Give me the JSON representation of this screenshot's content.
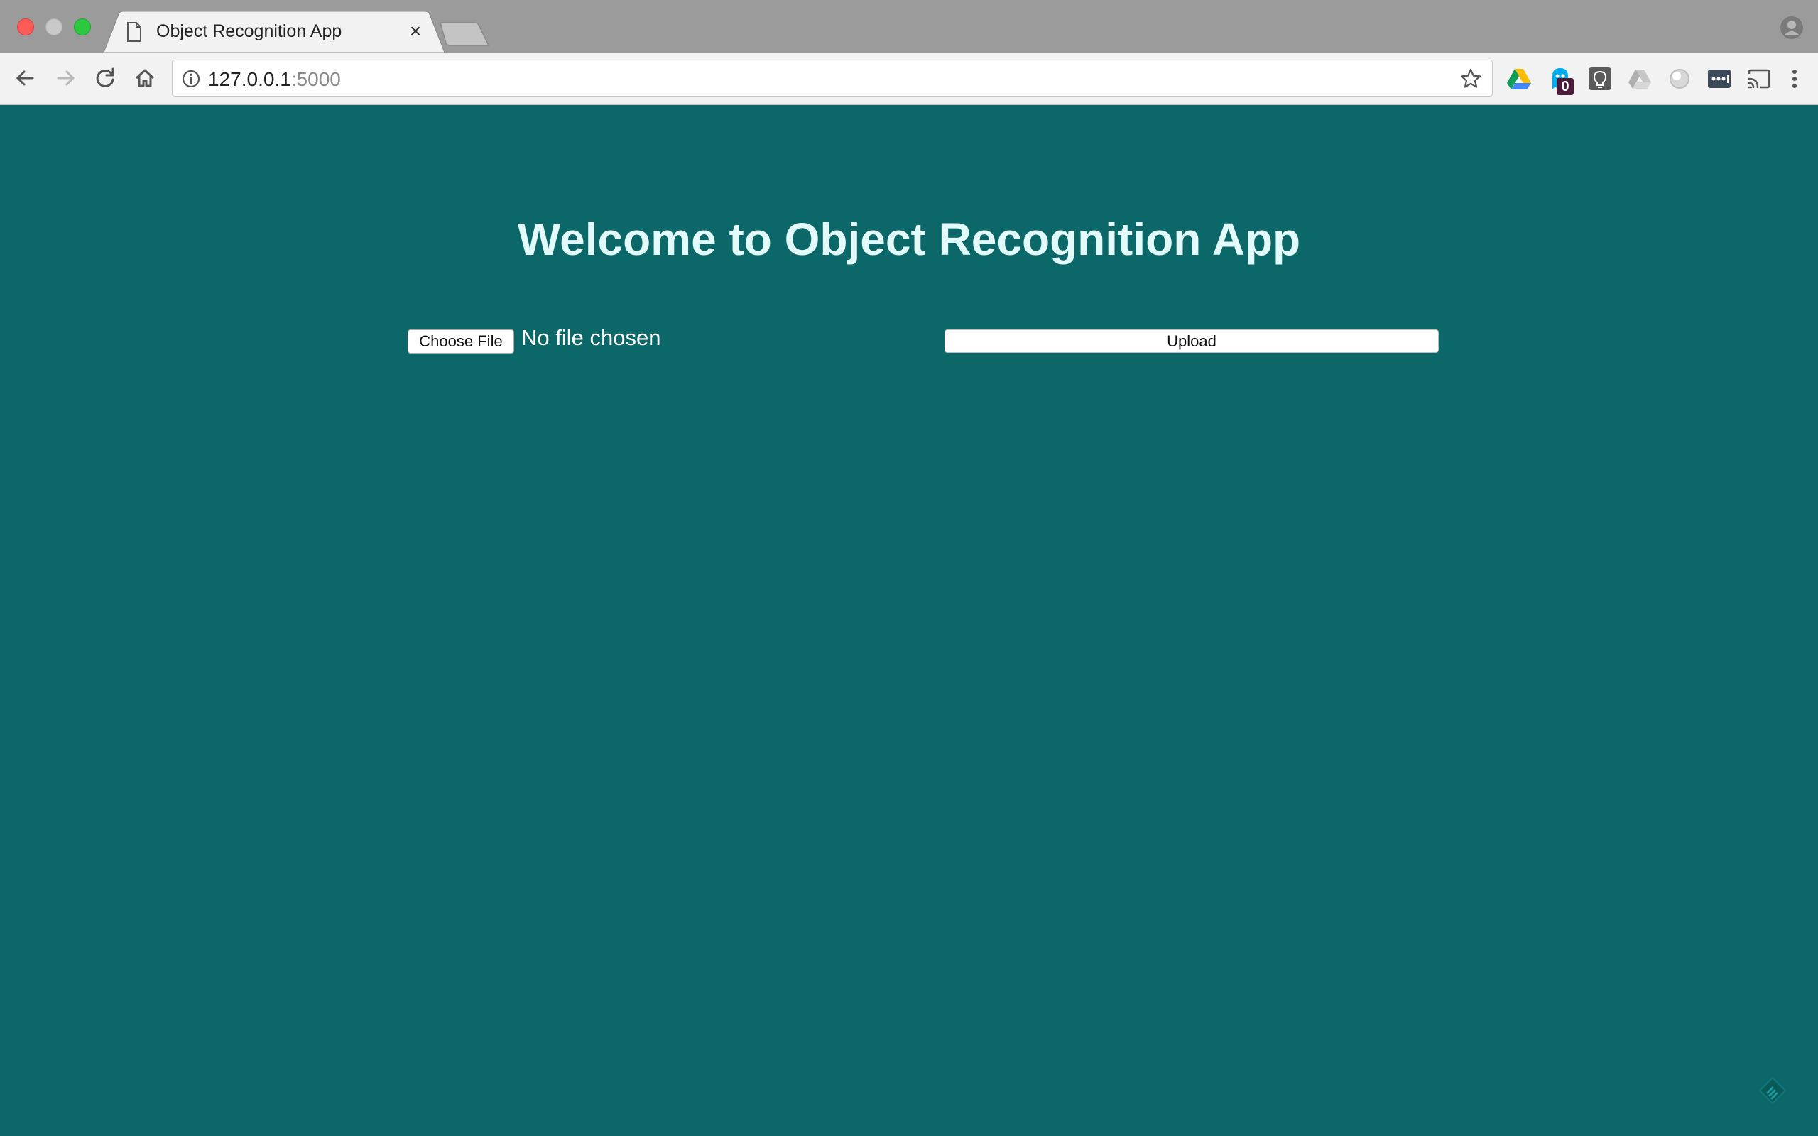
{
  "browser": {
    "tab": {
      "title": "Object Recognition App",
      "close_glyph": "×",
      "icon": "document-icon"
    },
    "omnibox": {
      "host": "127.0.0.1",
      "port": ":5000",
      "info_icon": "info-icon",
      "star_icon": "star-icon"
    },
    "navigation": [
      "back-icon",
      "forward-icon",
      "reload-icon",
      "home-icon"
    ],
    "extensions": [
      {
        "name": "google-drive-icon"
      },
      {
        "name": "ghostery-icon",
        "badge": "0"
      },
      {
        "name": "lightbulb-icon"
      },
      {
        "name": "drive-grey-icon"
      },
      {
        "name": "circle-extension-icon"
      },
      {
        "name": "lastpass-icon"
      },
      {
        "name": "cast-icon"
      },
      {
        "name": "menu-icon"
      }
    ]
  },
  "page": {
    "title": "Welcome to Object Recognition App",
    "file_input": {
      "button_label": "Choose File",
      "status": "No file chosen"
    },
    "upload_label": "Upload"
  },
  "colors": {
    "page_background": "#0c6868",
    "title_text": "#e2fafa",
    "tabstrip": "#9b9b9b",
    "toolbar": "#f2f2f2"
  }
}
